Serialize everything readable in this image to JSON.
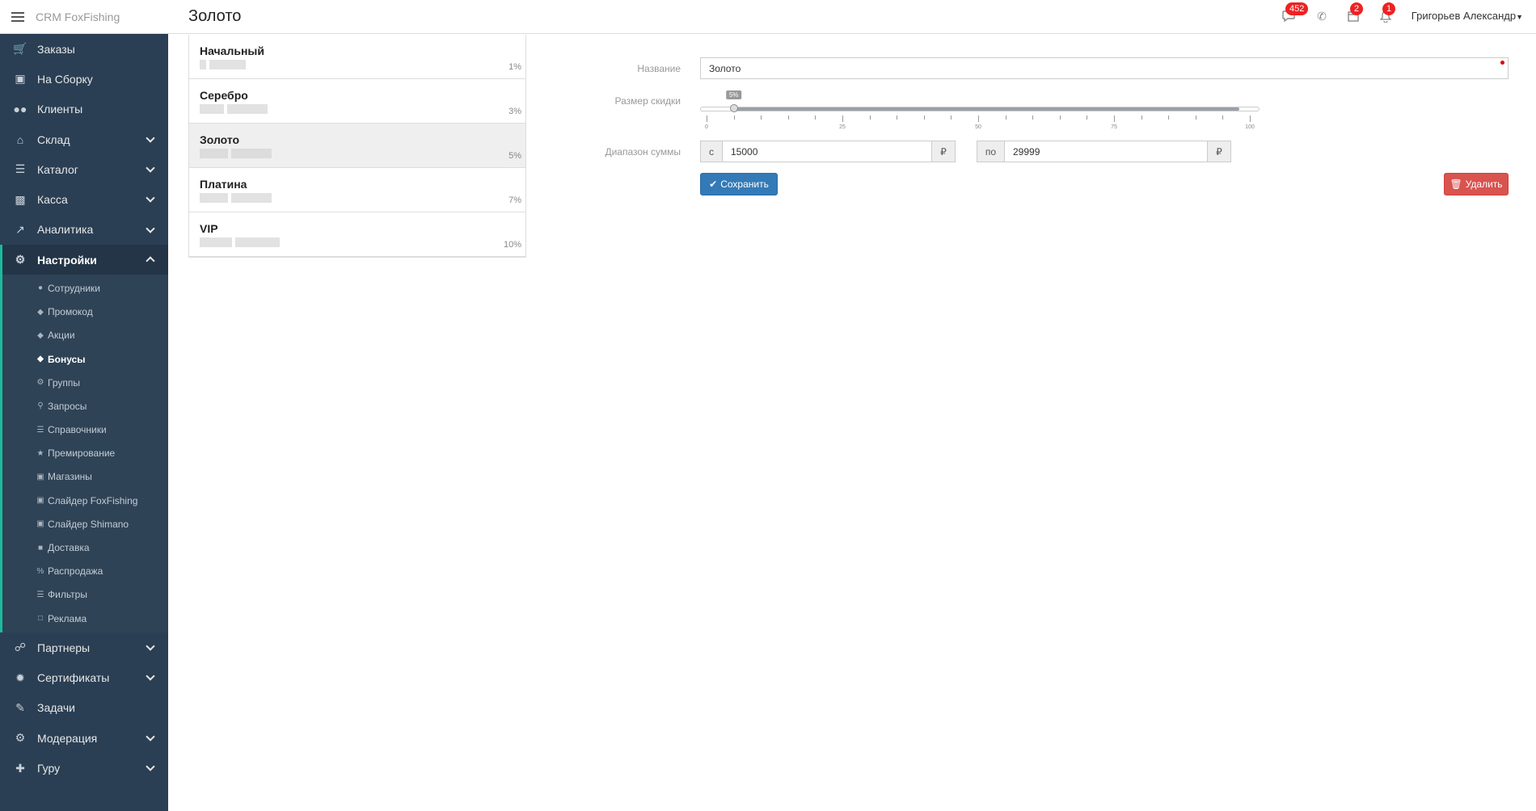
{
  "app": {
    "brand": "CRM FoxFishing",
    "page_title": "Золото"
  },
  "header": {
    "messages_badge": "452",
    "calendar_badge": "2",
    "notifications_badge": "1",
    "user_name": "Григорьев Александр"
  },
  "sidebar": {
    "items": [
      {
        "label": "Заказы",
        "icon": "cart-icon"
      },
      {
        "label": "На Сборку",
        "icon": "archive-icon"
      },
      {
        "label": "Клиенты",
        "icon": "users-icon"
      },
      {
        "label": "Склад",
        "icon": "home-icon"
      },
      {
        "label": "Каталог",
        "icon": "list-icon"
      },
      {
        "label": "Касса",
        "icon": "money-icon"
      },
      {
        "label": "Аналитика",
        "icon": "chart-line-icon"
      },
      {
        "label": "Настройки",
        "icon": "cogs-icon"
      },
      {
        "label": "Партнеры",
        "icon": "handshake-icon"
      },
      {
        "label": "Сертификаты",
        "icon": "certificate-icon"
      },
      {
        "label": "Задачи",
        "icon": "tasks-icon"
      },
      {
        "label": "Модерация",
        "icon": "cogs-icon"
      },
      {
        "label": "Гуру",
        "icon": "walking-icon"
      }
    ],
    "settings_sub": [
      {
        "label": "Сотрудники",
        "icon": "users-icon"
      },
      {
        "label": "Промокод",
        "icon": "tags-icon"
      },
      {
        "label": "Акции",
        "icon": "tags-icon"
      },
      {
        "label": "Бонусы",
        "icon": "tags-icon"
      },
      {
        "label": "Группы",
        "icon": "gear-icon"
      },
      {
        "label": "Запросы",
        "icon": "search-icon"
      },
      {
        "label": "Справочники",
        "icon": "list-icon"
      },
      {
        "label": "Премирование",
        "icon": "trophy-icon"
      },
      {
        "label": "Магазины",
        "icon": "cart-icon"
      },
      {
        "label": "Слайдер FoxFishing",
        "icon": "cart-icon"
      },
      {
        "label": "Слайдер Shimano",
        "icon": "cart-icon"
      },
      {
        "label": "Доставка",
        "icon": "truck-icon"
      },
      {
        "label": "Распродажа",
        "icon": "percent-icon"
      },
      {
        "label": "Фильтры",
        "icon": "list-icon"
      },
      {
        "label": "Реклама",
        "icon": "bookmark-icon"
      }
    ]
  },
  "levels": [
    {
      "name": "Начальный",
      "percent": "1%"
    },
    {
      "name": "Серебро",
      "percent": "3%"
    },
    {
      "name": "Золото",
      "percent": "5%"
    },
    {
      "name": "Платина",
      "percent": "7%"
    },
    {
      "name": "VIP",
      "percent": "10%"
    }
  ],
  "form": {
    "name_label": "Название",
    "name_value": "Золото",
    "discount_label": "Размер скидки",
    "discount_value": 5,
    "discount_tooltip": "5%",
    "slider_scale": [
      "0",
      "25",
      "50",
      "75",
      "100"
    ],
    "range_label": "Диапазон суммы",
    "from_prefix": "с",
    "from_value": "15000",
    "to_prefix": "по",
    "to_value": "29999",
    "currency": "₽",
    "save_label": "Сохранить",
    "delete_label": "Удалить"
  },
  "colors": {
    "sidebar_bg": "#2a3f54",
    "accent": "#1abb9c",
    "primary": "#337ab7",
    "danger": "#d9534f",
    "badge": "#ee2222"
  }
}
